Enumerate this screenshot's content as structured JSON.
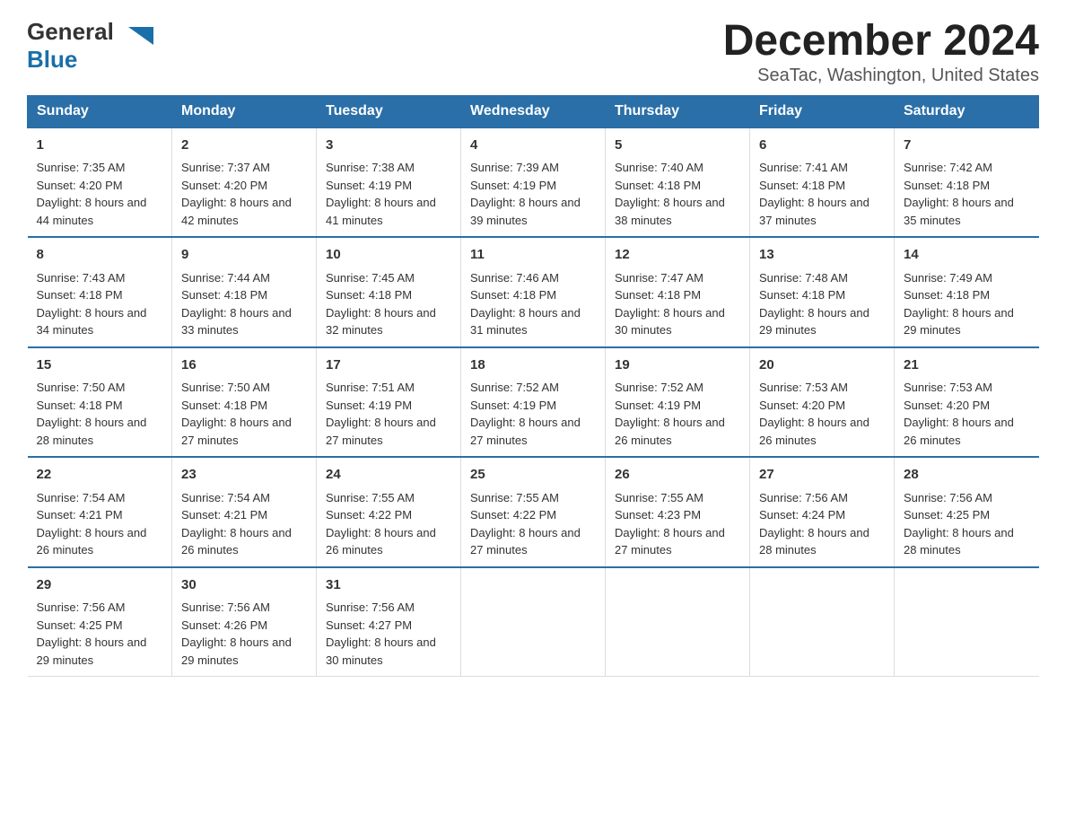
{
  "header": {
    "logo_general": "General",
    "logo_blue": "Blue",
    "title": "December 2024",
    "subtitle": "SeaTac, Washington, United States"
  },
  "weekdays": [
    "Sunday",
    "Monday",
    "Tuesday",
    "Wednesday",
    "Thursday",
    "Friday",
    "Saturday"
  ],
  "weeks": [
    [
      {
        "day": "1",
        "sunrise": "7:35 AM",
        "sunset": "4:20 PM",
        "daylight": "8 hours and 44 minutes."
      },
      {
        "day": "2",
        "sunrise": "7:37 AM",
        "sunset": "4:20 PM",
        "daylight": "8 hours and 42 minutes."
      },
      {
        "day": "3",
        "sunrise": "7:38 AM",
        "sunset": "4:19 PM",
        "daylight": "8 hours and 41 minutes."
      },
      {
        "day": "4",
        "sunrise": "7:39 AM",
        "sunset": "4:19 PM",
        "daylight": "8 hours and 39 minutes."
      },
      {
        "day": "5",
        "sunrise": "7:40 AM",
        "sunset": "4:18 PM",
        "daylight": "8 hours and 38 minutes."
      },
      {
        "day": "6",
        "sunrise": "7:41 AM",
        "sunset": "4:18 PM",
        "daylight": "8 hours and 37 minutes."
      },
      {
        "day": "7",
        "sunrise": "7:42 AM",
        "sunset": "4:18 PM",
        "daylight": "8 hours and 35 minutes."
      }
    ],
    [
      {
        "day": "8",
        "sunrise": "7:43 AM",
        "sunset": "4:18 PM",
        "daylight": "8 hours and 34 minutes."
      },
      {
        "day": "9",
        "sunrise": "7:44 AM",
        "sunset": "4:18 PM",
        "daylight": "8 hours and 33 minutes."
      },
      {
        "day": "10",
        "sunrise": "7:45 AM",
        "sunset": "4:18 PM",
        "daylight": "8 hours and 32 minutes."
      },
      {
        "day": "11",
        "sunrise": "7:46 AM",
        "sunset": "4:18 PM",
        "daylight": "8 hours and 31 minutes."
      },
      {
        "day": "12",
        "sunrise": "7:47 AM",
        "sunset": "4:18 PM",
        "daylight": "8 hours and 30 minutes."
      },
      {
        "day": "13",
        "sunrise": "7:48 AM",
        "sunset": "4:18 PM",
        "daylight": "8 hours and 29 minutes."
      },
      {
        "day": "14",
        "sunrise": "7:49 AM",
        "sunset": "4:18 PM",
        "daylight": "8 hours and 29 minutes."
      }
    ],
    [
      {
        "day": "15",
        "sunrise": "7:50 AM",
        "sunset": "4:18 PM",
        "daylight": "8 hours and 28 minutes."
      },
      {
        "day": "16",
        "sunrise": "7:50 AM",
        "sunset": "4:18 PM",
        "daylight": "8 hours and 27 minutes."
      },
      {
        "day": "17",
        "sunrise": "7:51 AM",
        "sunset": "4:19 PM",
        "daylight": "8 hours and 27 minutes."
      },
      {
        "day": "18",
        "sunrise": "7:52 AM",
        "sunset": "4:19 PM",
        "daylight": "8 hours and 27 minutes."
      },
      {
        "day": "19",
        "sunrise": "7:52 AM",
        "sunset": "4:19 PM",
        "daylight": "8 hours and 26 minutes."
      },
      {
        "day": "20",
        "sunrise": "7:53 AM",
        "sunset": "4:20 PM",
        "daylight": "8 hours and 26 minutes."
      },
      {
        "day": "21",
        "sunrise": "7:53 AM",
        "sunset": "4:20 PM",
        "daylight": "8 hours and 26 minutes."
      }
    ],
    [
      {
        "day": "22",
        "sunrise": "7:54 AM",
        "sunset": "4:21 PM",
        "daylight": "8 hours and 26 minutes."
      },
      {
        "day": "23",
        "sunrise": "7:54 AM",
        "sunset": "4:21 PM",
        "daylight": "8 hours and 26 minutes."
      },
      {
        "day": "24",
        "sunrise": "7:55 AM",
        "sunset": "4:22 PM",
        "daylight": "8 hours and 26 minutes."
      },
      {
        "day": "25",
        "sunrise": "7:55 AM",
        "sunset": "4:22 PM",
        "daylight": "8 hours and 27 minutes."
      },
      {
        "day": "26",
        "sunrise": "7:55 AM",
        "sunset": "4:23 PM",
        "daylight": "8 hours and 27 minutes."
      },
      {
        "day": "27",
        "sunrise": "7:56 AM",
        "sunset": "4:24 PM",
        "daylight": "8 hours and 28 minutes."
      },
      {
        "day": "28",
        "sunrise": "7:56 AM",
        "sunset": "4:25 PM",
        "daylight": "8 hours and 28 minutes."
      }
    ],
    [
      {
        "day": "29",
        "sunrise": "7:56 AM",
        "sunset": "4:25 PM",
        "daylight": "8 hours and 29 minutes."
      },
      {
        "day": "30",
        "sunrise": "7:56 AM",
        "sunset": "4:26 PM",
        "daylight": "8 hours and 29 minutes."
      },
      {
        "day": "31",
        "sunrise": "7:56 AM",
        "sunset": "4:27 PM",
        "daylight": "8 hours and 30 minutes."
      },
      null,
      null,
      null,
      null
    ]
  ]
}
